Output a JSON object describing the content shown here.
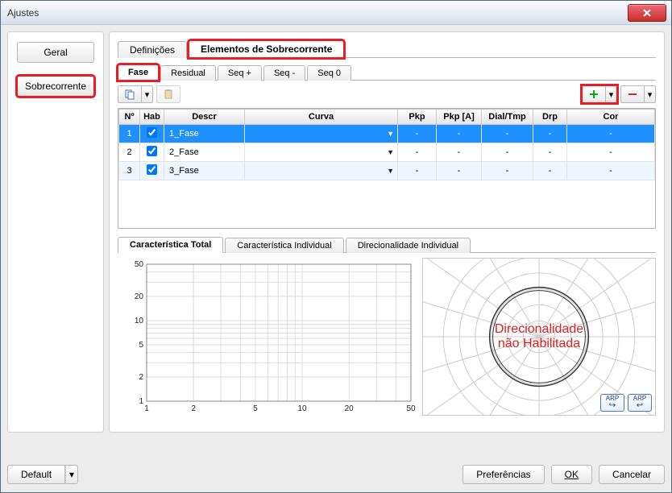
{
  "window": {
    "title": "Ajustes"
  },
  "sidebar": {
    "items": [
      {
        "label": "Geral"
      },
      {
        "label": "Sobrecorrente"
      }
    ]
  },
  "topTabs": [
    {
      "label": "Definições",
      "active": false
    },
    {
      "label": "Elementos de Sobrecorrente",
      "active": true
    }
  ],
  "subTabs": [
    {
      "label": "Fase",
      "active": true
    },
    {
      "label": "Residual",
      "active": false
    },
    {
      "label": "Seq +",
      "active": false
    },
    {
      "label": "Seq -",
      "active": false
    },
    {
      "label": "Seq 0",
      "active": false
    }
  ],
  "tableHeaders": [
    "Nº",
    "Hab",
    "Descr",
    "Curva",
    "Pkp",
    "Pkp [A]",
    "Dial/Tmp",
    "Drp",
    "Cor"
  ],
  "rows": [
    {
      "n": "1",
      "hab": true,
      "descr": "1_Fase",
      "pkp": "-",
      "pkpa": "-",
      "dial": "-",
      "drp": "-",
      "cor": "-",
      "selected": true
    },
    {
      "n": "2",
      "hab": true,
      "descr": "2_Fase",
      "pkp": "-",
      "pkpa": "-",
      "dial": "-",
      "drp": "-",
      "cor": "-",
      "selected": false
    },
    {
      "n": "3",
      "hab": true,
      "descr": "3_Fase",
      "pkp": "-",
      "pkpa": "-",
      "dial": "-",
      "drp": "-",
      "cor": "-",
      "selected": false
    }
  ],
  "chartTabs": [
    {
      "label": "Característica Total",
      "active": true
    },
    {
      "label": "Característica Individual",
      "active": false
    },
    {
      "label": "Direcionalidade Individual",
      "active": false
    }
  ],
  "polar": {
    "line1": "Direcionalidade",
    "line2": "não Habilitada"
  },
  "arp": {
    "label": "ARP"
  },
  "footer": {
    "default": "Default",
    "prefs": "Preferências",
    "ok": "OK",
    "cancel": "Cancelar"
  },
  "chart_data": {
    "type": "line",
    "title": "",
    "x_ticks": [
      1.0,
      2.0,
      5.0,
      10,
      20,
      50
    ],
    "y_ticks": [
      1.0,
      2.0,
      5.0,
      10,
      20,
      50
    ],
    "x_scale": "log",
    "y_scale": "log",
    "xlim": [
      1.0,
      50
    ],
    "ylim": [
      1.0,
      50
    ],
    "series": []
  }
}
